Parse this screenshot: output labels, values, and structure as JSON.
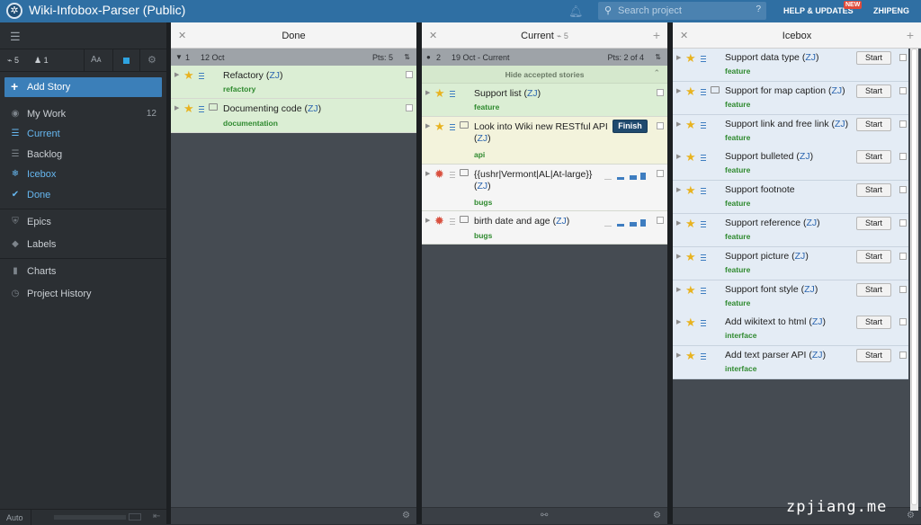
{
  "topbar": {
    "title": "Wiki-Infobox-Parser (Public)",
    "search_placeholder": "Search project",
    "search_help": "?",
    "help": "HELP & UPDATES",
    "new_badge": "NEW",
    "user": "ZHIPENG"
  },
  "sidebar": {
    "velocity": "5",
    "members": "1",
    "add_story": "Add Story",
    "nav": [
      {
        "label": "My Work",
        "count": "12",
        "icon": "eye-icon"
      },
      {
        "label": "Current",
        "icon": "list-icon",
        "active": true
      },
      {
        "label": "Backlog",
        "icon": "list-icon"
      },
      {
        "label": "Icebox",
        "icon": "snowflake-icon",
        "active": true
      },
      {
        "label": "Done",
        "icon": "check-icon",
        "active": true
      },
      {
        "label": "Epics",
        "icon": "shield-icon"
      },
      {
        "label": "Labels",
        "icon": "tag-icon"
      },
      {
        "label": "Charts",
        "icon": "bar-chart-icon"
      },
      {
        "label": "Project History",
        "icon": "clock-icon"
      }
    ],
    "bottom_auto": "Auto"
  },
  "done": {
    "title": "Done",
    "iteration": {
      "number": "1",
      "date": "12 Oct",
      "points": "Pts: 5"
    },
    "stories": [
      {
        "name": "Refactory",
        "owner": "ZJ",
        "label": "refactory"
      },
      {
        "name": "Documenting code",
        "owner": "ZJ",
        "label": "documentation"
      }
    ]
  },
  "current": {
    "title": "Current",
    "velocity": "5",
    "iteration": {
      "number": "2",
      "date": "19 Oct - Current",
      "points": "Pts: 2 of 4"
    },
    "hide_accepted": "Hide accepted stories",
    "stories": [
      {
        "name": "Support list",
        "owner": "ZJ",
        "label": "feature"
      },
      {
        "name": "Look into Wiki new RESTful API",
        "owner": "ZJ",
        "label": "api",
        "button": "Finish"
      },
      {
        "name": "{{ushr|Vermont|AL|At-large}}",
        "owner": "ZJ",
        "label": "bugs"
      },
      {
        "name": "birth date and age",
        "owner": "ZJ",
        "label": "bugs"
      }
    ]
  },
  "icebox": {
    "title": "Icebox",
    "start_label": "Start",
    "stories": [
      {
        "name": "Support data type",
        "owner": "ZJ",
        "label": "feature"
      },
      {
        "name": "Support for map caption",
        "owner": "ZJ",
        "label": "feature"
      },
      {
        "name": "Support link and free link",
        "owner": "ZJ",
        "label": "feature"
      },
      {
        "name": "Support bulleted",
        "owner": "ZJ",
        "label": "feature"
      },
      {
        "name": "Support footnote",
        "owner": "",
        "label": "feature"
      },
      {
        "name": "Support reference",
        "owner": "ZJ",
        "label": "feature"
      },
      {
        "name": "Support picture",
        "owner": "ZJ",
        "label": "feature"
      },
      {
        "name": "Support font style",
        "owner": "ZJ",
        "label": "feature"
      },
      {
        "name": "Add wikitext to html",
        "owner": "ZJ",
        "label": "interface"
      },
      {
        "name": "Add text parser API",
        "owner": "ZJ",
        "label": "interface"
      }
    ]
  },
  "watermark": "zpjiang.me"
}
